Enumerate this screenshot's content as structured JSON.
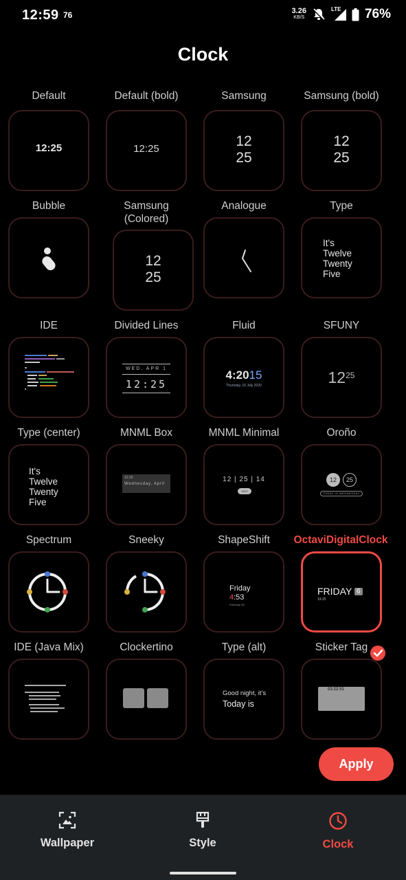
{
  "status": {
    "time": "12:59",
    "extra": "76",
    "speed": "3.26",
    "speed_unit": "KB/S",
    "network": "LTE",
    "battery": "76%"
  },
  "page_title": "Clock",
  "clocks": [
    {
      "label": "Default",
      "preview": {
        "text": "12:25"
      }
    },
    {
      "label": "Default (bold)",
      "preview": {
        "text": "12:25"
      }
    },
    {
      "label": "Samsung",
      "preview": {
        "line1": "12",
        "line2": "25"
      }
    },
    {
      "label": "Samsung (bold)",
      "preview": {
        "line1": "12",
        "line2": "25"
      }
    },
    {
      "label": "Bubble",
      "preview": {}
    },
    {
      "label": "Samsung\n(Colored)",
      "preview": {
        "line1": "12",
        "line2": "25"
      }
    },
    {
      "label": "Analogue",
      "preview": {}
    },
    {
      "label": "Type",
      "preview": {
        "lines": [
          "It's",
          "Twelve",
          "Twenty",
          "Five"
        ]
      }
    },
    {
      "label": "IDE",
      "preview": {}
    },
    {
      "label": "Divided Lines",
      "preview": {
        "date": "WED, APR 1",
        "time": "12:25"
      }
    },
    {
      "label": "Fluid",
      "preview": {
        "time": "4:20",
        "time_accent": "15",
        "date": "Thursday, 16 July 2020"
      }
    },
    {
      "label": "SFUNY",
      "preview": {
        "hour": "12",
        "minute": "25"
      }
    },
    {
      "label": "Type (center)",
      "preview": {
        "lines": [
          "It's",
          "Twelve",
          "Twenty",
          "Five"
        ]
      }
    },
    {
      "label": "MNML Box",
      "preview": {
        "top": "12:25",
        "date": "Wednesday, April"
      }
    },
    {
      "label": "MNML Minimal",
      "preview": {
        "time": "12 | 25 | 14",
        "pill": "WED"
      }
    },
    {
      "label": "Oroño",
      "preview": {
        "h": "12",
        "m": "25",
        "bar": "TODAY IS WEDNESDAY"
      }
    },
    {
      "label": "Spectrum",
      "preview": {}
    },
    {
      "label": "Sneeky",
      "preview": {}
    },
    {
      "label": "ShapeShift",
      "preview": {
        "day": "Friday",
        "hour": "4",
        "minute": ":53",
        "date": "February 28"
      }
    },
    {
      "label": "OctaviDigitalClock",
      "preview": {
        "day": "FRIDAY",
        "num": "6",
        "time": "19:25"
      }
    },
    {
      "label": "IDE (Java Mix)",
      "preview": {}
    },
    {
      "label": "Clockertino",
      "preview": {}
    },
    {
      "label": "Type (alt)",
      "preview": {
        "line1": "Good night, it's",
        "line2": "Today is"
      }
    },
    {
      "label": "Sticker Tag",
      "preview": {
        "time": "03:22:51"
      }
    }
  ],
  "selected_index": 19,
  "apply_label": "Apply",
  "nav": [
    {
      "label": "Wallpaper",
      "icon": "wallpaper-icon"
    },
    {
      "label": "Style",
      "icon": "brush-icon"
    },
    {
      "label": "Clock",
      "icon": "clock-icon"
    }
  ],
  "accent_color": "#ef4a44",
  "border_color": "#3b1c1c",
  "nav_bg": "#1f2224"
}
